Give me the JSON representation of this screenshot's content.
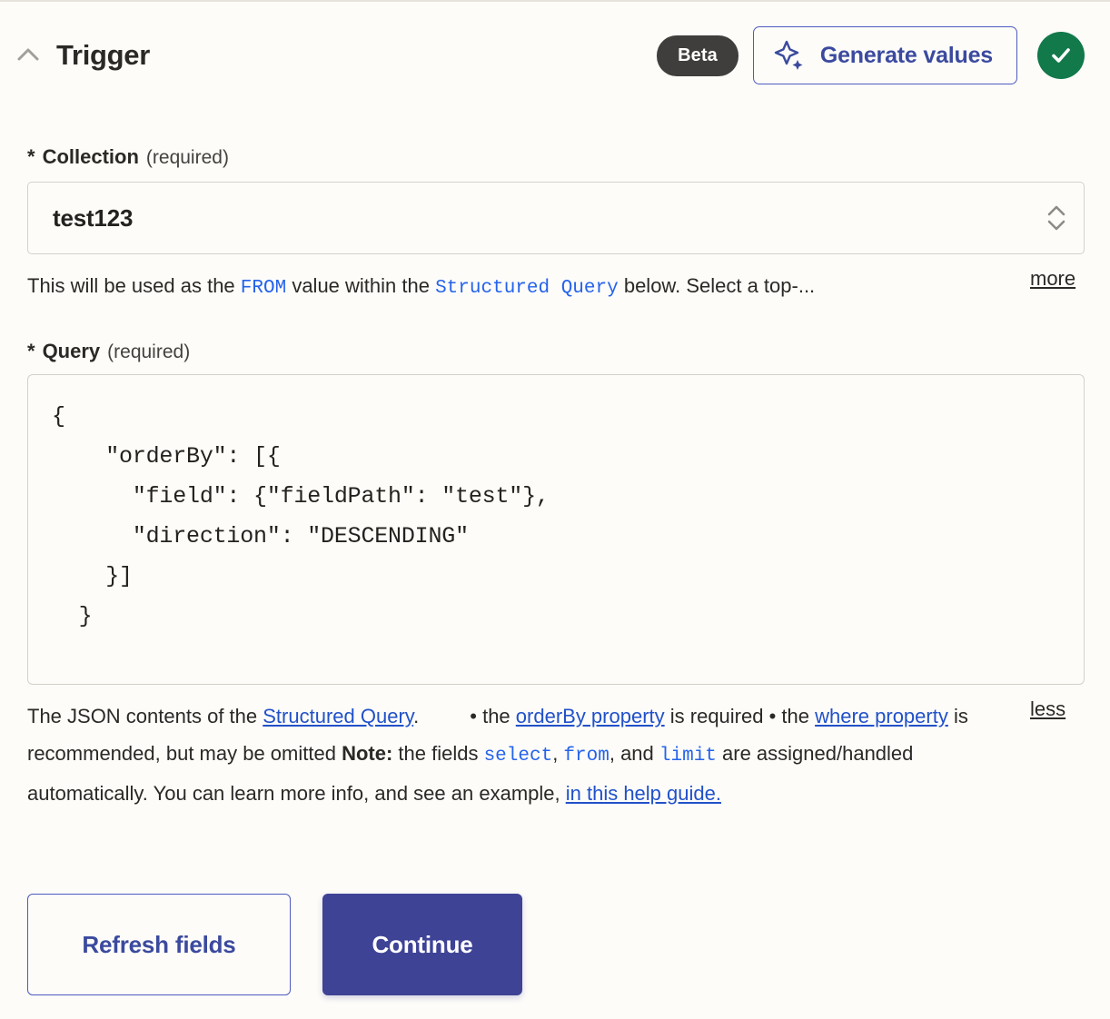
{
  "header": {
    "collapse_icon": "chevron-up-icon",
    "title": "Trigger",
    "beta_badge": "Beta",
    "generate_button": {
      "label": "Generate values",
      "icon": "sparkle-icon",
      "color": "#3B4A9E"
    },
    "status": {
      "icon": "check-circle-icon",
      "color": "#12794A"
    }
  },
  "collection_field": {
    "required_marker": "*",
    "label": "Collection",
    "requirement": "(required)",
    "value": "test123",
    "stepper_icon": "chevron-up-down-icon",
    "help": {
      "part1": "This will be used as the ",
      "code1": "FROM",
      "part2": " value within the ",
      "code2": "Structured Query",
      "part3": " below. Select a top-...",
      "toggle": "more"
    }
  },
  "query_field": {
    "required_marker": "*",
    "label": "Query",
    "requirement": "(required)",
    "value": "{\n    \"orderBy\": [{\n      \"field\": {\"fieldPath\": \"test\"},\n      \"direction\": \"DESCENDING\"\n    }]\n  }",
    "help": {
      "t1": "The JSON contents of the ",
      "link1": "Structured Query",
      "t2": ".",
      "t3": "• the ",
      "link2": "orderBy property",
      "t4": " is required • the ",
      "link3": "where property",
      "t5": " is recommended, but may be omitted ",
      "note": "Note:",
      "t6": " the fields ",
      "code1": "select",
      "t7": ", ",
      "code2": "from",
      "t8": ", and ",
      "code3": "limit",
      "t9": " are assigned/handled automatically. You can learn more info, and see an example, ",
      "link4": "in this help guide.",
      "toggle": "less"
    }
  },
  "actions": {
    "refresh_label": "Refresh fields",
    "continue_label": "Continue"
  },
  "colors": {
    "accent_indigo": "#3B4A9E",
    "primary_button": "#3E4395",
    "link_blue": "#2151C9",
    "code_blue": "#2563EB",
    "success_green": "#12794A",
    "badge_dark": "#403E3C",
    "page_background": "#FDFCF9",
    "border_gray": "#D4D1CA"
  }
}
